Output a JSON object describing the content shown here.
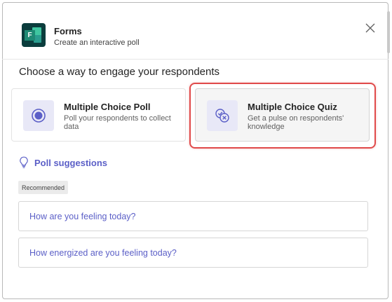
{
  "app": {
    "title": "Forms",
    "subtitle": "Create an interactive poll",
    "icon_letter": "F"
  },
  "heading": "Choose a way to engage your respondents",
  "cards": [
    {
      "title": "Multiple Choice Poll",
      "description": "Poll your respondents to collect data",
      "icon": "radio-button-icon"
    },
    {
      "title": "Multiple Choice Quiz",
      "description": "Get a pulse on respondents' knowledge",
      "icon": "quiz-check-icon",
      "highlighted": true
    }
  ],
  "suggestions": {
    "label": "Poll suggestions",
    "tag": "Recommended",
    "items": [
      "How are you feeling today?",
      "How energized are you feeling today?"
    ]
  },
  "colors": {
    "accent": "#5b5fc7",
    "highlight": "#e04a4a",
    "app_icon_bg": "#0b3d3d"
  }
}
